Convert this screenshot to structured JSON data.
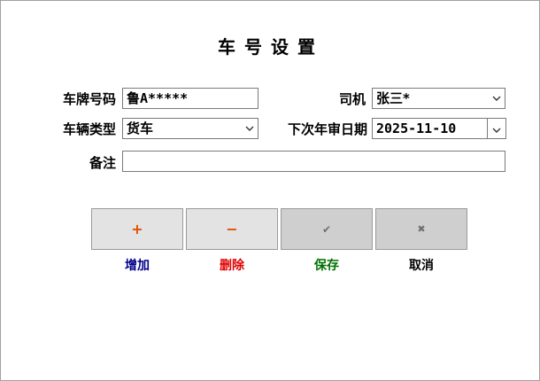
{
  "title": "车号设置",
  "labels": {
    "plate": "车牌号码",
    "driver": "司机",
    "vehicle_type": "车辆类型",
    "next_inspection": "下次年审日期",
    "remark": "备注"
  },
  "fields": {
    "plate_value": "鲁A*****",
    "driver_value": "张三*",
    "vehicle_type_value": "货车",
    "next_inspection_value": "2025-11-10",
    "remark_value": ""
  },
  "buttons": [
    {
      "icon": "plus-icon",
      "glyph": "+",
      "label": "增加",
      "color": "#00008b",
      "icon_color": "#e05000"
    },
    {
      "icon": "minus-icon",
      "glyph": "−",
      "label": "删除",
      "color": "#e00000",
      "icon_color": "#e05000"
    },
    {
      "icon": "check-icon",
      "glyph": "✔",
      "label": "保存",
      "color": "#007000",
      "icon_color": "#707070"
    },
    {
      "icon": "x-icon",
      "glyph": "✖",
      "label": "取消",
      "color": "#000000",
      "icon_color": "#707070"
    }
  ]
}
